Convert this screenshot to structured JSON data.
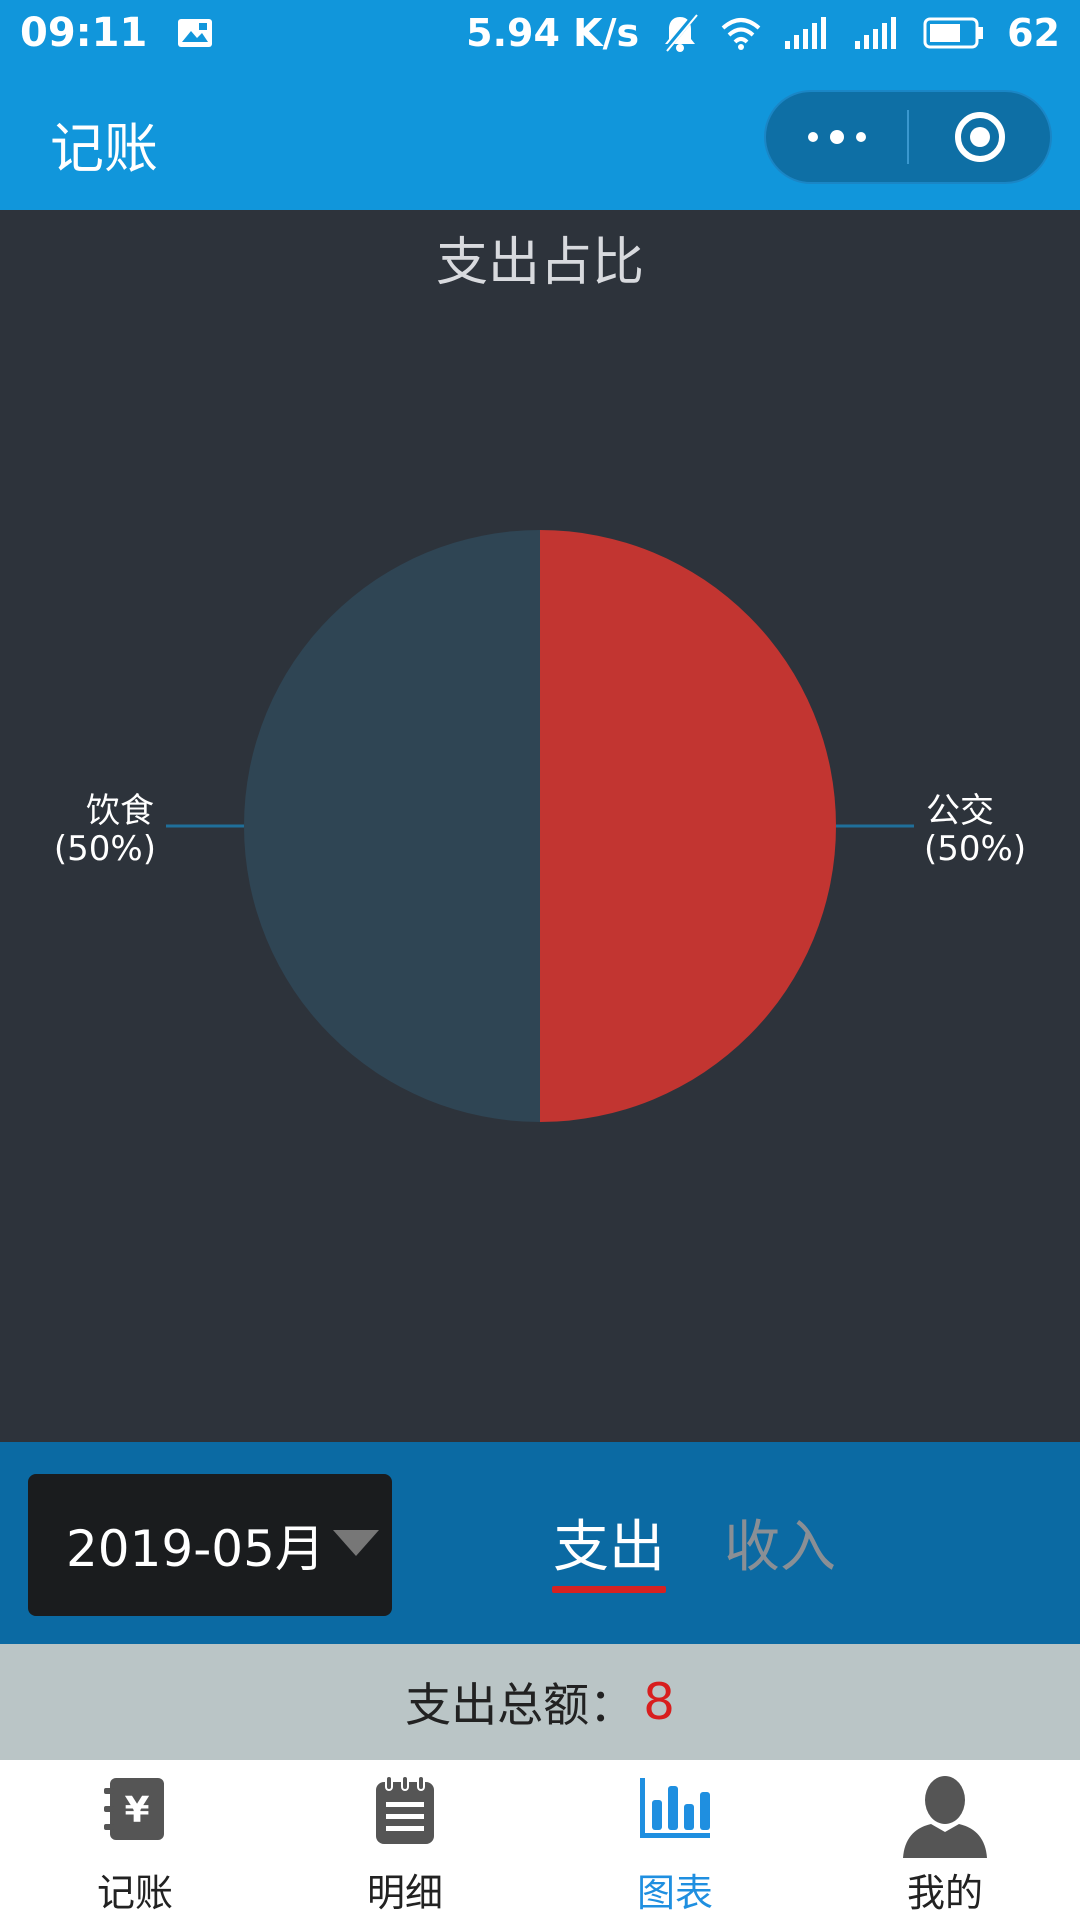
{
  "status_bar": {
    "time": "09:11",
    "speed": "5.94 K/s",
    "battery": "62",
    "icons": [
      "gallery-icon",
      "mute-icon",
      "wifi-icon",
      "signal-4g-icon",
      "signal-icon",
      "battery-icon"
    ]
  },
  "nav": {
    "title": "记账",
    "capsule_icons": [
      "more-dots-icon",
      "close-target-icon"
    ]
  },
  "chart_data": {
    "type": "pie",
    "title": "支出占比",
    "slices": [
      {
        "name": "公交",
        "value": 50,
        "label": "(50%)",
        "color": "#c23531",
        "side": "right"
      },
      {
        "name": "饮食",
        "value": 50,
        "label": "(50%)",
        "color": "#2f4554",
        "side": "left"
      }
    ],
    "background": "#2d333b",
    "leader_line_color": "#1f6f9a"
  },
  "filter": {
    "month": "2019-05月",
    "tabs": [
      {
        "label": "支出",
        "active": true
      },
      {
        "label": "收入",
        "active": false
      }
    ]
  },
  "total": {
    "label": "支出总额：",
    "value": "8"
  },
  "tabbar": {
    "items": [
      {
        "label": "记账",
        "icon": "yen-book-icon",
        "active": false
      },
      {
        "label": "明细",
        "icon": "notepad-icon",
        "active": false
      },
      {
        "label": "图表",
        "icon": "bar-chart-icon",
        "active": true
      },
      {
        "label": "我的",
        "icon": "user-icon",
        "active": false
      }
    ]
  },
  "colors": {
    "brand": "#1196db",
    "tab_active": "#1f8fe0",
    "accent_red": "#d62222"
  }
}
